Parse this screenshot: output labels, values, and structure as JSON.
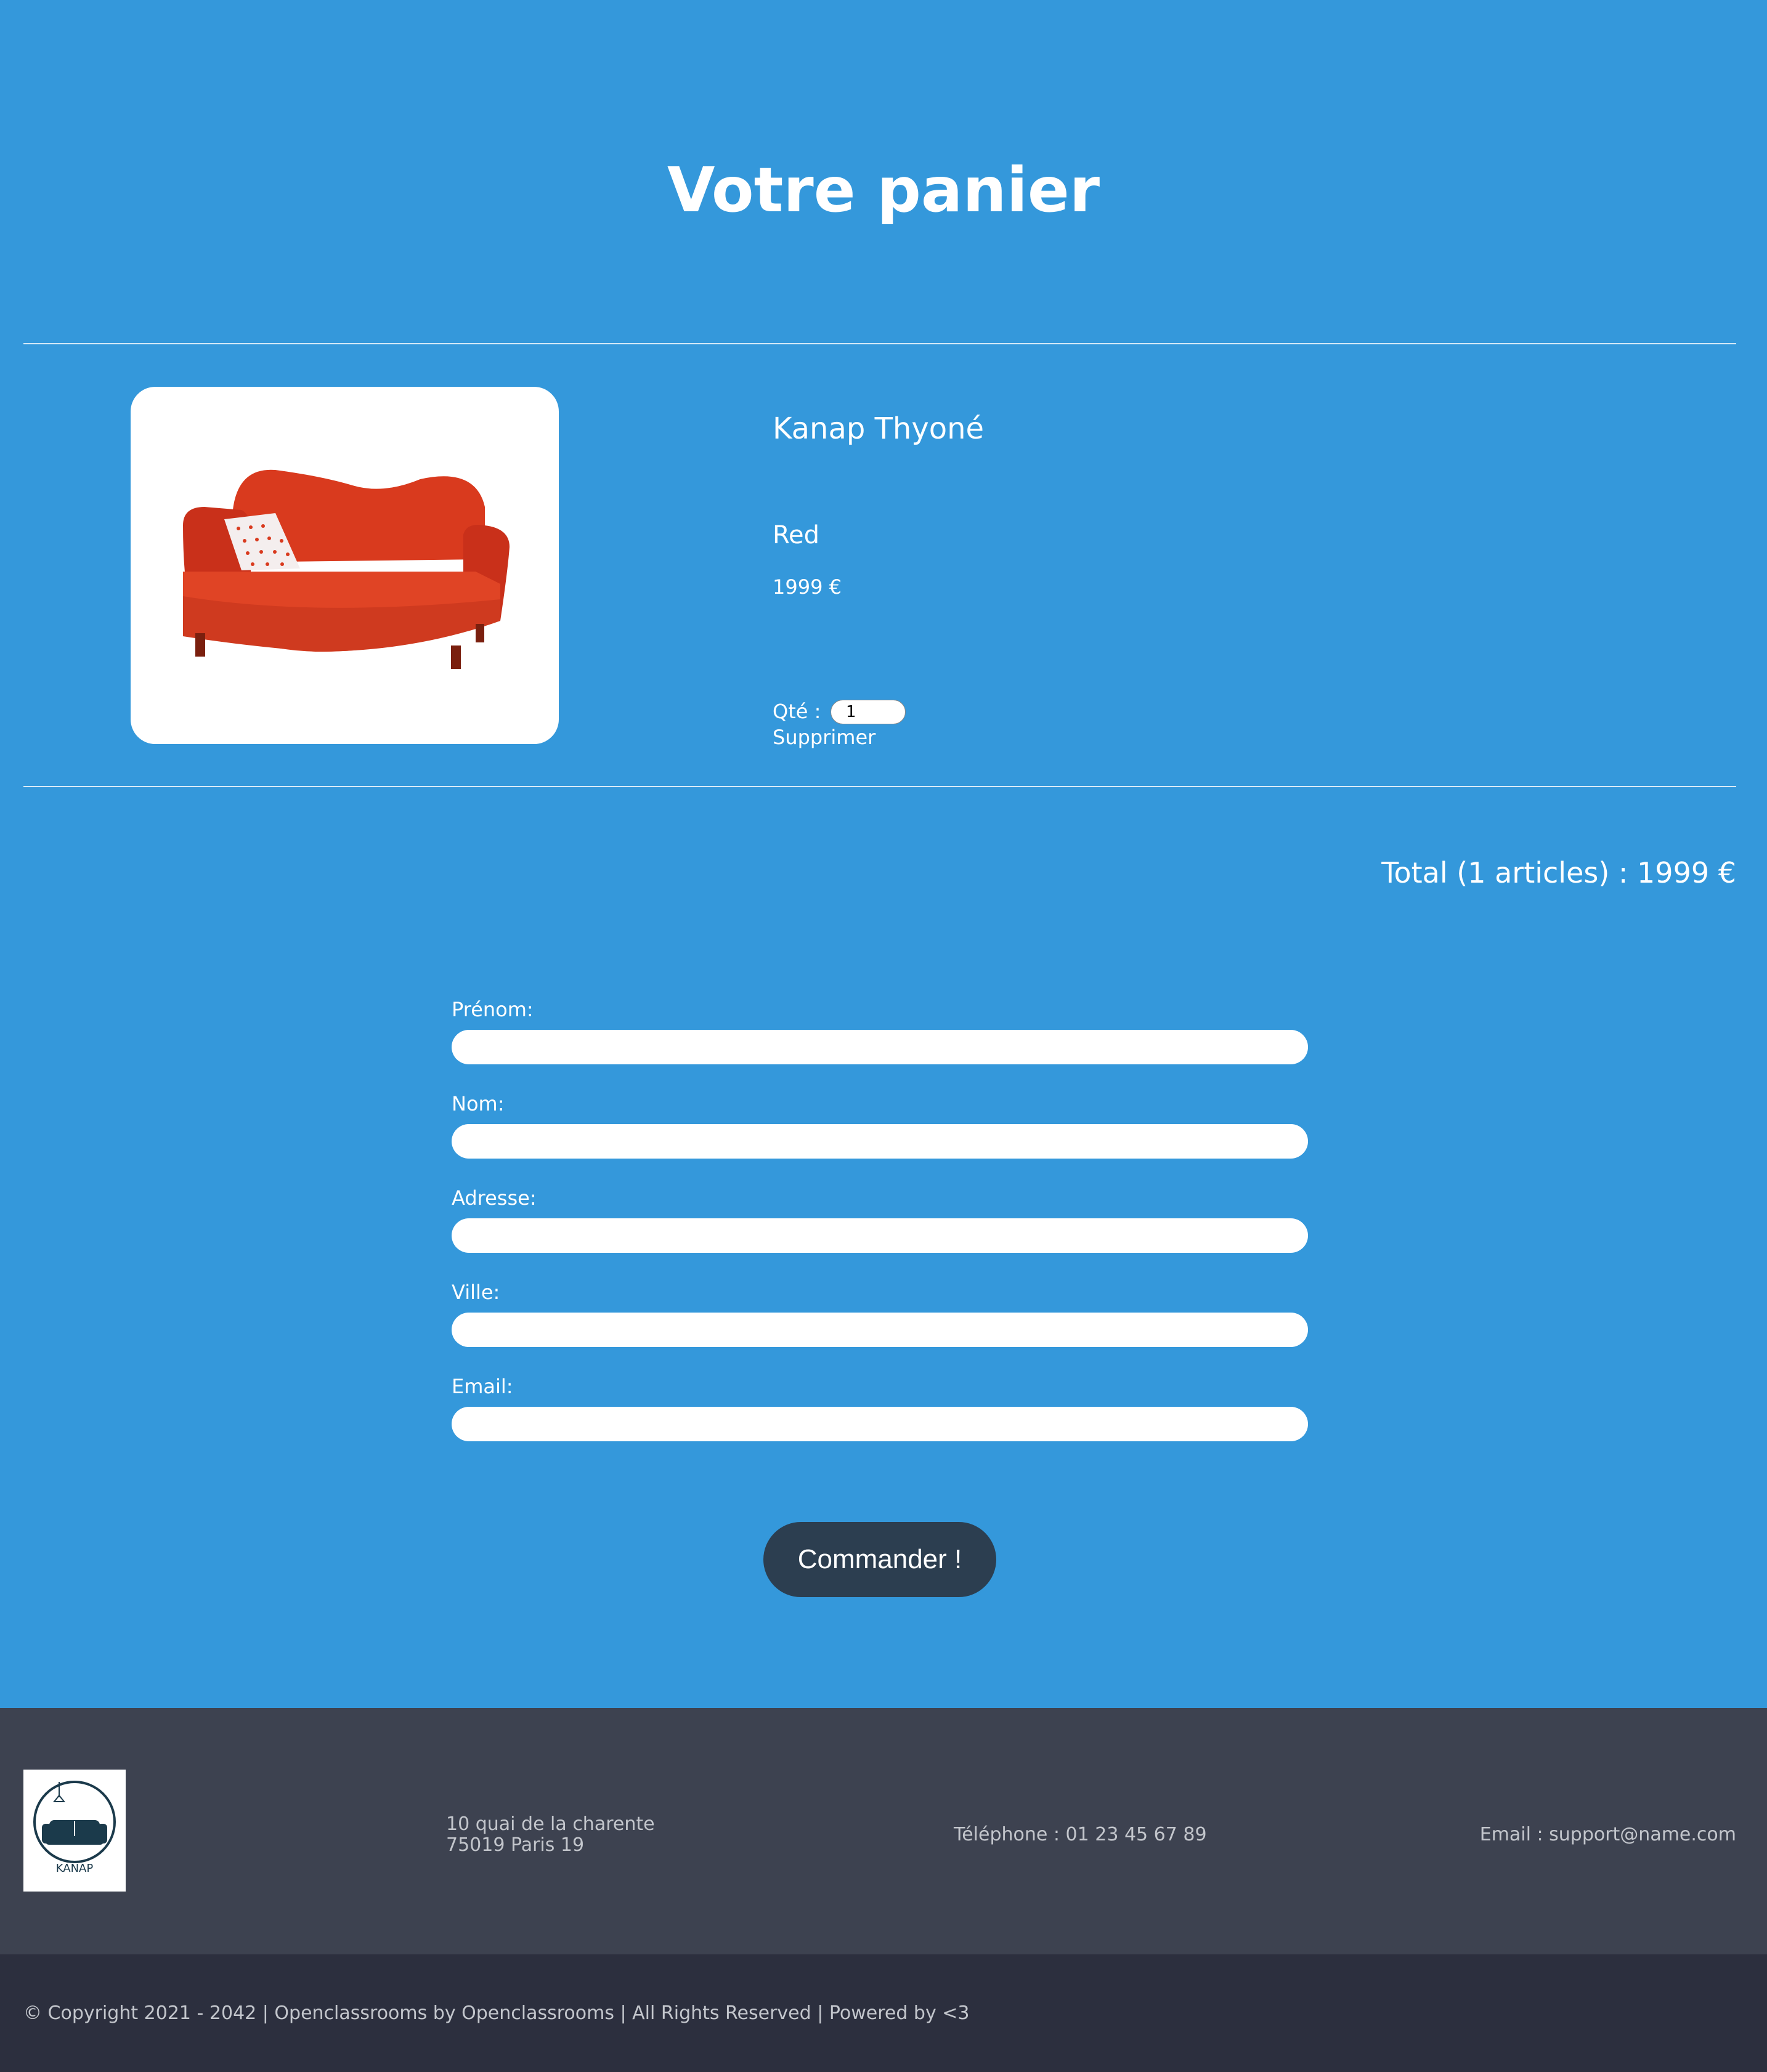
{
  "page": {
    "title": "Votre panier"
  },
  "cart": {
    "items": [
      {
        "name": "Kanap Thyoné",
        "color": "Red",
        "price": "1999 €",
        "qty_label": "Qté :",
        "qty_value": "1",
        "delete_label": "Supprimer"
      }
    ],
    "total": "Total (1 articles) : 1999 €"
  },
  "form": {
    "firstname_label": "Prénom:",
    "lastname_label": "Nom:",
    "address_label": "Adresse:",
    "city_label": "Ville:",
    "email_label": "Email:",
    "submit_label": "Commander !"
  },
  "footer": {
    "logo_text": "KANAP",
    "address_line1": "10 quai de la charente",
    "address_line2": "75019 Paris 19",
    "phone": "Téléphone : 01 23 45 67 89",
    "email": "Email : support@name.com",
    "copyright": "© Copyright 2021 - 2042 | Openclassrooms by Openclassrooms | All Rights Reserved | Powered by <3"
  },
  "colors": {
    "background": "#3498db",
    "button": "#2c3e50",
    "footer": "#3d4250",
    "bottom_bar": "#2c2f3e",
    "sofa": "#d93a1e"
  },
  "icons": {
    "product_image": "red-sofa-image",
    "logo": "kanap-logo"
  }
}
